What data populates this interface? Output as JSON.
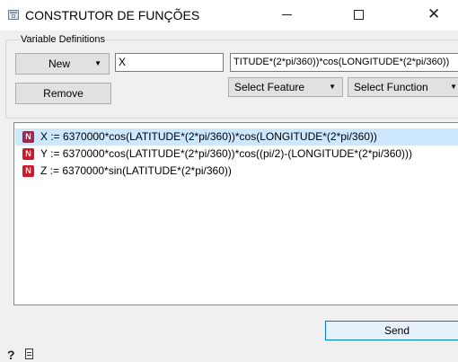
{
  "window": {
    "title": "CONSTRUTOR DE FUNÇÕES",
    "close_glyph": "✕"
  },
  "variable_definitions": {
    "group_label": "Variable Definitions",
    "new_button_label": "New",
    "remove_button_label": "Remove",
    "name_value": "X",
    "expression_value": "TITUDE*(2*pi/360))*cos(LONGITUDE*(2*pi/360))",
    "select_feature_label": "Select Feature",
    "select_function_label": "Select Function"
  },
  "definitions_list": {
    "badge_letter": "N",
    "items": [
      {
        "text": "X := 6370000*cos(LATITUDE*(2*pi/360))*cos(LONGITUDE*(2*pi/360))",
        "selected": true
      },
      {
        "text": "Y := 6370000*cos(LATITUDE*(2*pi/360))*cos((pi/2)-(LONGITUDE*(2*pi/360)))",
        "selected": false
      },
      {
        "text": "Z := 6370000*sin(LATITUDE*(2*pi/360))",
        "selected": false
      }
    ]
  },
  "footer": {
    "send_button_label": "Send",
    "help_glyph": "?"
  },
  "icons": {
    "app": "app-window-icon",
    "dropdown": "chevron-down-icon",
    "badge": "variable-badge-icon",
    "help": "help-icon",
    "report": "document-icon"
  },
  "colors": {
    "badge": "#cc1c2c",
    "badge_selected": "#9c2a4c",
    "selection": "#cce8ff",
    "send_border": "#0078d7"
  }
}
